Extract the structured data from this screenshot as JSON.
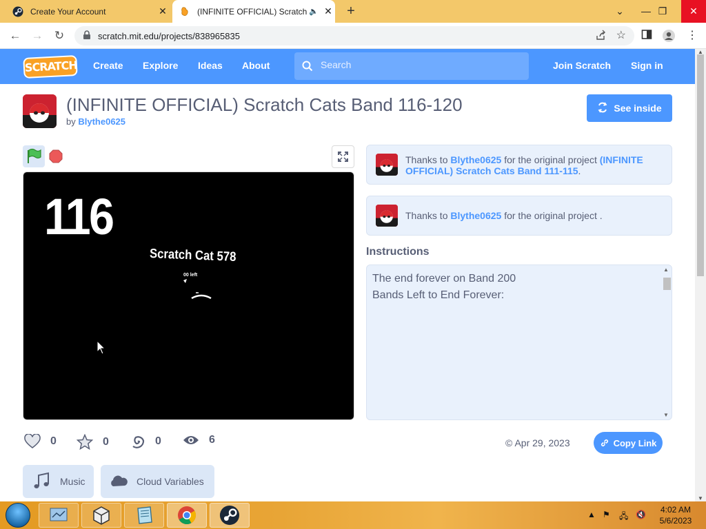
{
  "browser": {
    "tabs": [
      {
        "title": "Create Your Account"
      },
      {
        "title": "(INFINITE OFFICIAL) Scratch"
      }
    ],
    "new_tab": "+",
    "url": "scratch.mit.edu/projects/838965835"
  },
  "scratch_nav": {
    "logo": "SCRATCH",
    "links": [
      "Create",
      "Explore",
      "Ideas",
      "About"
    ],
    "search_placeholder": "Search",
    "join": "Join Scratch",
    "sign_in": "Sign in"
  },
  "project": {
    "title": "(INFINITE OFFICIAL) Scratch Cats Band 116-120",
    "by_label": "by",
    "author": "Blythe0625",
    "see_inside": "See inside"
  },
  "stage": {
    "number": "116",
    "cat_name": "Scratch Cat 578",
    "tiny_text": "00 left"
  },
  "credits": [
    {
      "prefix": "Thanks to",
      "user": "Blythe0625",
      "middle": "for the original project",
      "project": "(INFINITE OFFICIAL) Scratch Cats Band 111-115",
      "suffix": "."
    },
    {
      "prefix": "Thanks to",
      "user": "Blythe0625",
      "middle": "for the original project",
      "project": "",
      "suffix": "."
    }
  ],
  "instructions": {
    "heading": "Instructions",
    "lines": [
      "The end forever on Band 200",
      "Bands Left to End Forever:"
    ]
  },
  "stats": {
    "loves": "0",
    "favorites": "0",
    "remixes": "0",
    "views": "6"
  },
  "date": "Apr 29, 2023",
  "copy_link": "Copy Link",
  "extensions": [
    "Music",
    "Cloud Variables"
  ],
  "taskbar": {
    "time": "4:02 AM",
    "date": "5/6/2023"
  },
  "colors": {
    "scratch_blue": "#4c97ff",
    "text_gray": "#575e75",
    "panel_blue": "#e9f1fc",
    "tab_strip": "#f3c86a"
  }
}
